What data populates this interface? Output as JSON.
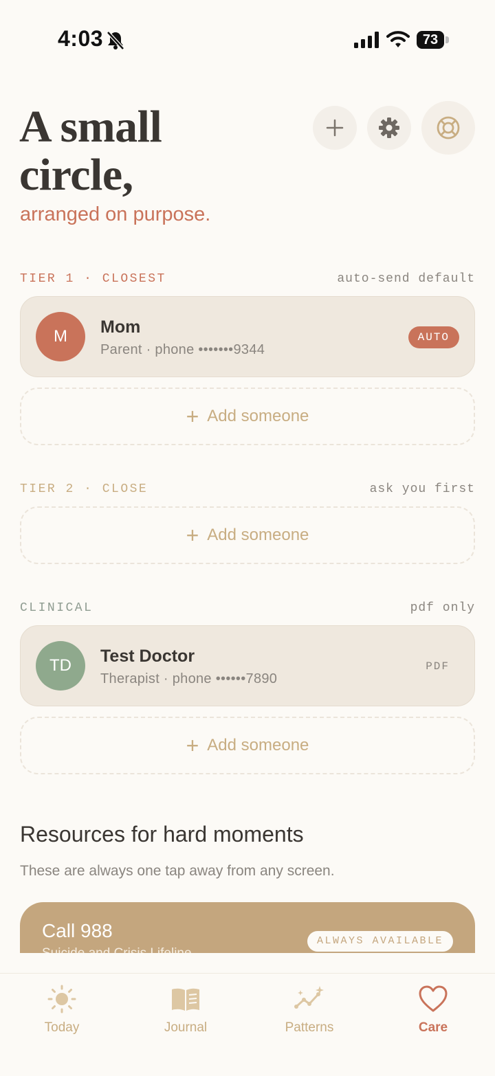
{
  "status_bar": {
    "time": "4:03",
    "battery": "73"
  },
  "header": {
    "title": "A small circle,",
    "subtitle": "arranged on purpose.",
    "buttons": {
      "add": "plus-icon",
      "settings": "gear-icon",
      "help": "lifebuoy-icon"
    }
  },
  "tiers": [
    {
      "label": "TIER 1 · CLOSEST",
      "note": "auto-send default",
      "label_color": "#c9735a",
      "contacts": [
        {
          "initials": "M",
          "name": "Mom",
          "detail": "Parent · phone •••••••9344",
          "badge": "AUTO",
          "avatar_color": "#c9735a"
        }
      ],
      "add_label": "Add someone"
    },
    {
      "label": "TIER 2 · CLOSE",
      "note": "ask you first",
      "label_color": "#c8ad82",
      "contacts": [],
      "add_label": "Add someone"
    },
    {
      "label": "CLINICAL",
      "note": "pdf only",
      "label_color": "#8f9c91",
      "contacts": [
        {
          "initials": "TD",
          "name": "Test Doctor",
          "detail": "Therapist · phone ••••••7890",
          "badge": "PDF",
          "avatar_color": "#8fa98d"
        }
      ],
      "add_label": "Add someone"
    }
  ],
  "resources": {
    "title": "Resources for hard moments",
    "subtitle": "These are always one tap away from any screen.",
    "call_card": {
      "title": "Call 988",
      "subtitle": "Suicide and Crisis Lifeline",
      "badge": "ALWAYS AVAILABLE",
      "color": "#c4a67e"
    }
  },
  "tabbar": {
    "active": "Care",
    "items": [
      {
        "label": "Today",
        "icon": "sun-icon"
      },
      {
        "label": "Journal",
        "icon": "book-icon"
      },
      {
        "label": "Patterns",
        "icon": "sparkle-chart-icon"
      },
      {
        "label": "Care",
        "icon": "heart-icon"
      }
    ]
  },
  "colors": {
    "accent": "#c9735a",
    "gold": "#c8ad82",
    "background": "#fcfaf6",
    "card": "#efe8de"
  }
}
